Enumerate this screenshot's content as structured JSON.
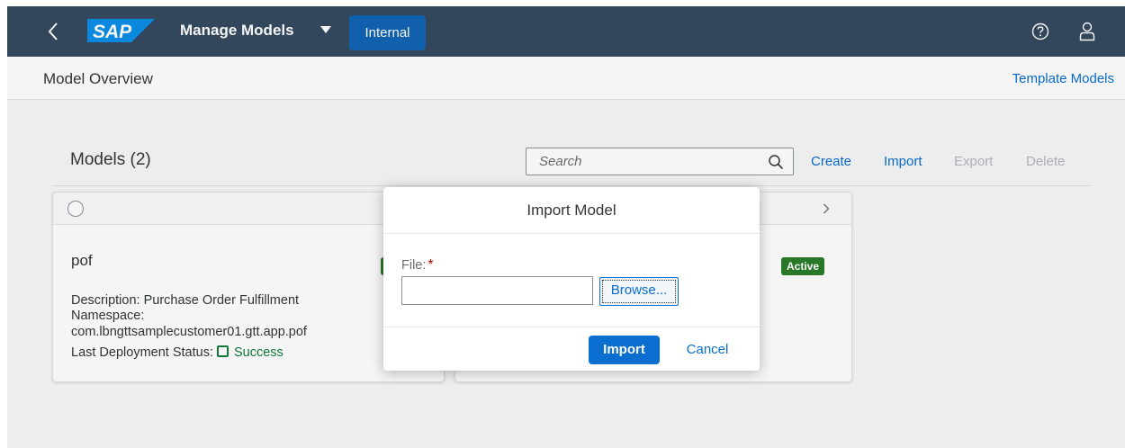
{
  "shell": {
    "logo_text": "SAP",
    "app_title": "Manage Models",
    "environment_badge": "Internal",
    "icons": [
      "back-icon",
      "sap-logo",
      "dropdown-arrow-icon",
      "help-icon",
      "user-icon"
    ]
  },
  "subheader": {
    "page_title": "Model Overview",
    "template_link": "Template Models"
  },
  "models": {
    "title": "Models (2)",
    "search_placeholder": "Search",
    "toolbar": {
      "create": "Create",
      "import": "Import",
      "export": "Export",
      "delete": "Delete"
    },
    "cards": [
      {
        "name": "pof",
        "description": "Description: Purchase Order Fulfillment",
        "namespace_label": "Namespace:",
        "namespace": "com.lbngttsamplecustomer01.gtt.app.pof",
        "deployment_label": "Last Deployment Status:",
        "deployment_status": "Success"
      },
      {
        "badge": "Active"
      }
    ]
  },
  "dialog": {
    "title": "Import Model",
    "file_label": "File:",
    "required_marker": "*",
    "browse_label": "Browse...",
    "import_label": "Import",
    "cancel_label": "Cancel"
  },
  "colors": {
    "shell_bg": "#354a5f",
    "accent": "#0a6ed1",
    "badge_bg": "#1264b5",
    "success": "#107e3e",
    "active_badge": "#2b7d2b",
    "required": "#bb0000"
  }
}
